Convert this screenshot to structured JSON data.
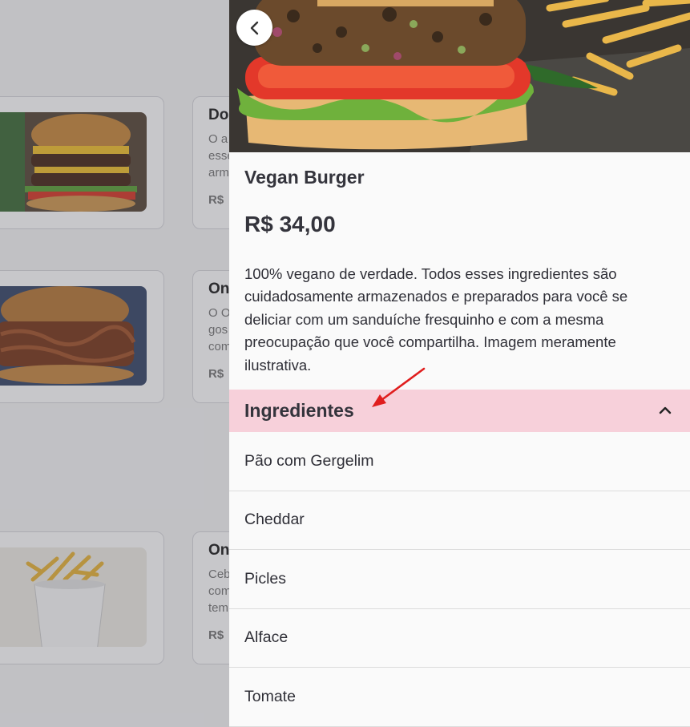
{
  "background_menu": {
    "items": [
      {
        "title": "Do",
        "desc_lines": [
          "O a",
          "esse",
          "arm"
        ],
        "price": "R$"
      },
      {
        "title": "On",
        "desc_lines": [
          "O O",
          "gos",
          "com"
        ],
        "price": "R$"
      },
      {
        "title": "On",
        "desc_lines": [
          "Ceb",
          "com",
          "tem"
        ],
        "price": "R$"
      }
    ]
  },
  "product": {
    "name": "Vegan Burger",
    "price": "R$ 34,00",
    "description": "100% vegano de verdade. Todos esses ingredientes são cuidadosamente armazenados e preparados para você se deliciar com um sanduíche fresquinho e com a mesma preocupação que você compartilha. Imagem meramente ilustrativa."
  },
  "ingredients": {
    "title": "Ingredientes",
    "expanded": true,
    "items": [
      "Pão com Gergelim",
      "Cheddar",
      "Picles",
      "Alface",
      "Tomate"
    ]
  },
  "icons": {
    "back": "chevron-left-icon",
    "collapse": "chevron-up-icon",
    "annotation": "red-arrow-icon"
  },
  "colors": {
    "ingredients_header_bg": "#f7d0da",
    "annotation_arrow": "#e01e1e"
  }
}
